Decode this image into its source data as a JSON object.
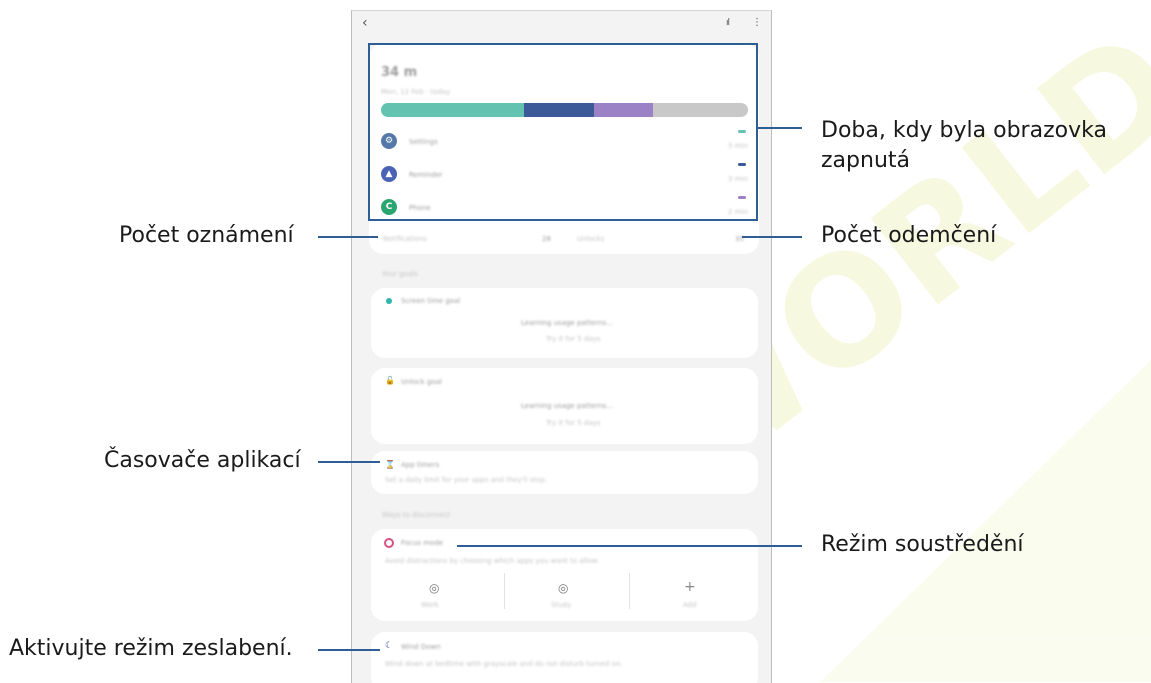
{
  "colors": {
    "callout_line": "#2d5f95",
    "bar_teal": "#63c3b0",
    "bar_navy": "#3d5a98",
    "bar_purple": "#9b82c6",
    "bar_gray": "#c8c8c8"
  },
  "screen": {
    "icons": {
      "back": "back-arrow-icon",
      "chart": "bar-chart-icon",
      "more": "more-options-icon"
    },
    "usage_bar": {
      "segments": [
        0.39,
        0.19,
        0.16,
        0.26
      ]
    },
    "apps": [
      {
        "icon": "gear-icon",
        "glyph": "⚙",
        "color": "#5479a8"
      },
      {
        "icon": "bixby-icon",
        "glyph": "▲",
        "color": "#4b63b5"
      },
      {
        "icon": "phone-icon",
        "glyph": "C",
        "color": "#2aa56f"
      }
    ],
    "goal_icons": {
      "screen_time": "clock-icon",
      "unlock": "lock-icon"
    },
    "timers_icon": "hourglass-icon",
    "focus_icon": "focus-icon",
    "focus_action_icons": [
      "focus-mode-icon",
      "focus-mode-icon",
      "add-icon"
    ],
    "wind_down_icon": "moon-icon"
  },
  "callouts": {
    "screen_time": "Doba, kdy byla obrazovka\nzapnutá",
    "notifications": "Počet oznámení",
    "unlocks": "Počet odemčení",
    "app_timers": "Časovače aplikací",
    "focus_mode": "Režim soustředění",
    "wind_down": "Aktivujte režim zeslabení."
  }
}
